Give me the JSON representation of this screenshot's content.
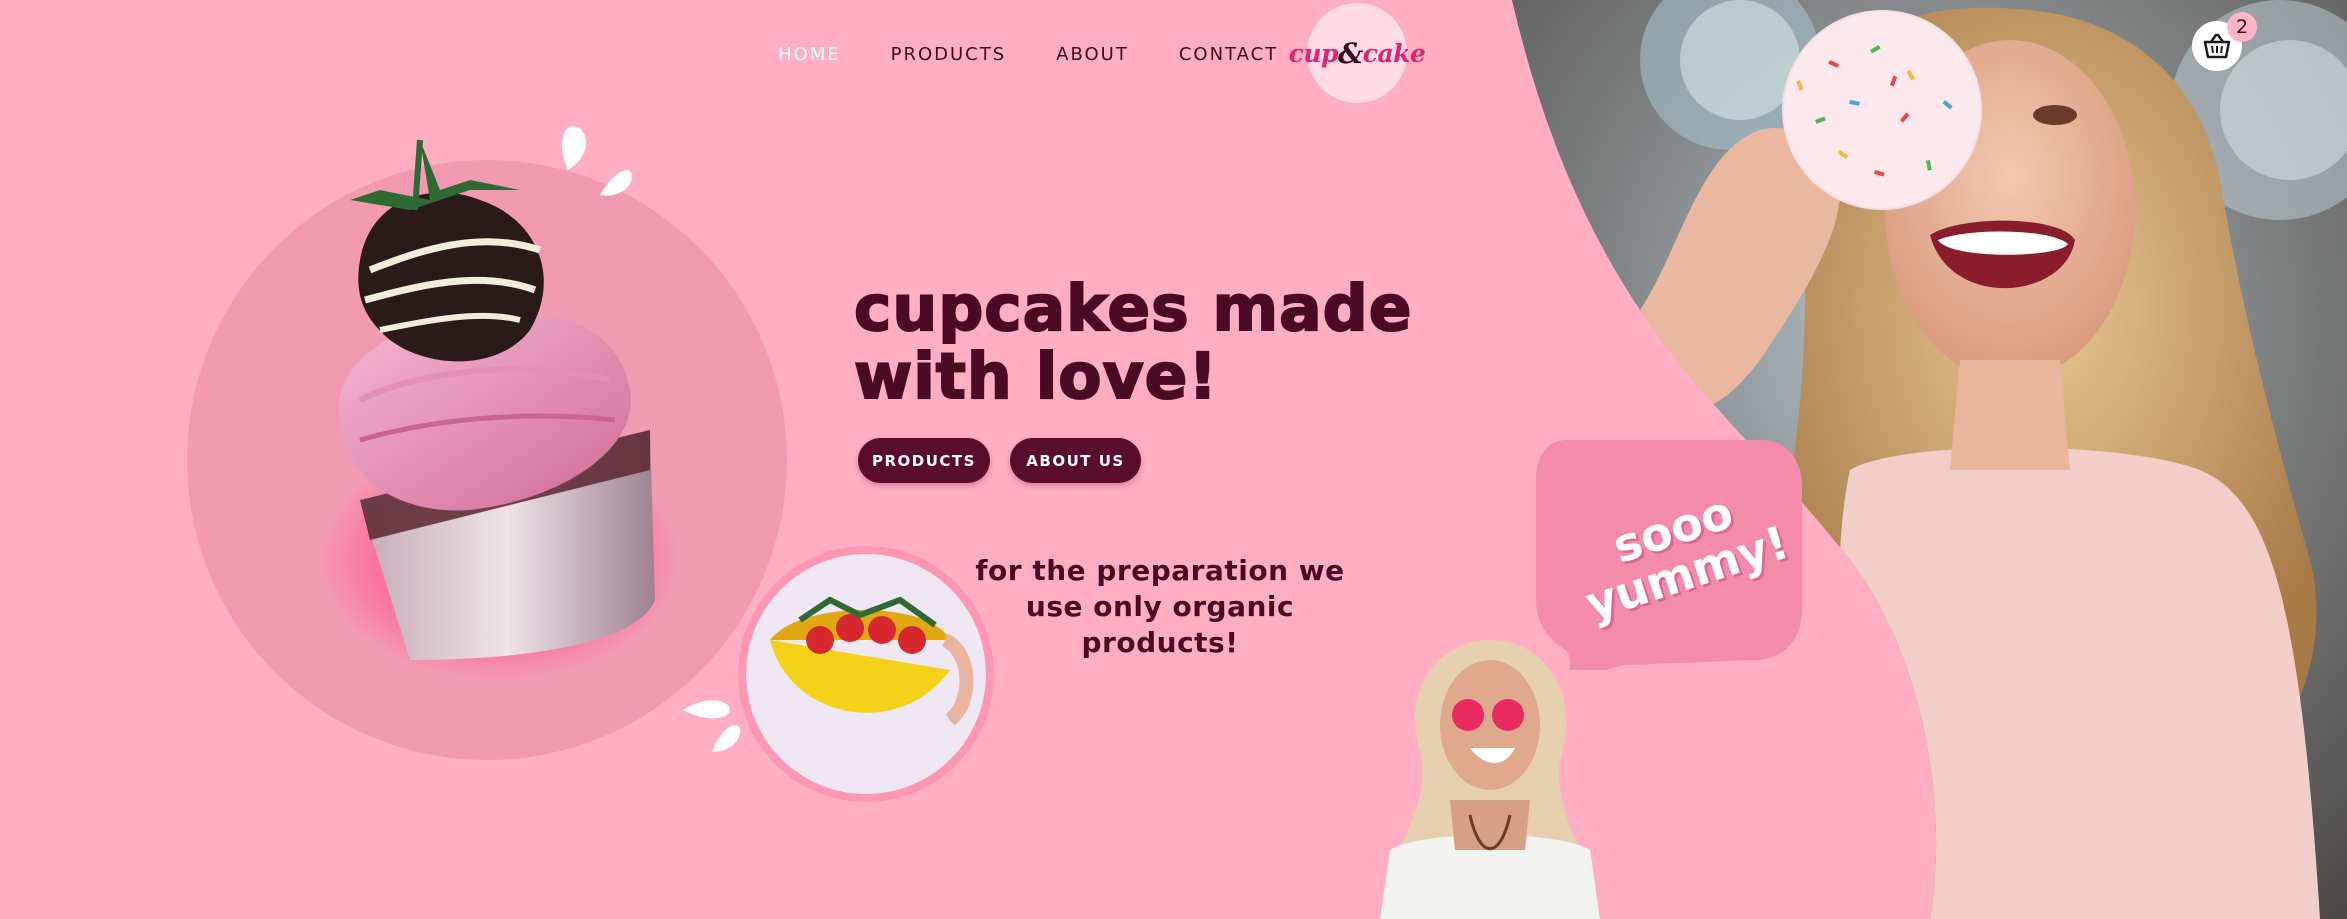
{
  "nav": {
    "items": [
      {
        "label": "HOME",
        "active": true
      },
      {
        "label": "PRODUCTS",
        "active": false
      },
      {
        "label": "ABOUT",
        "active": false
      },
      {
        "label": "CONTACT",
        "active": false
      }
    ]
  },
  "logo": {
    "part1": "cup",
    "amp": "&",
    "part2": "cake"
  },
  "cart": {
    "count": "2",
    "icon": "basket-icon"
  },
  "hero": {
    "headline_line1": "cupcakes made",
    "headline_line2": "with love!",
    "btn_products": "PRODUCTS",
    "btn_about": "ABOUT US"
  },
  "organic": {
    "line1": "for the preparation we",
    "line2": "use only organic",
    "line3": "products!"
  },
  "speech": {
    "line1": "sooo",
    "line2": "yummy!"
  },
  "colors": {
    "background": "#ffaec3",
    "headline": "#4b0a24",
    "button": "#5a0d2b",
    "accent": "#e0246b"
  }
}
